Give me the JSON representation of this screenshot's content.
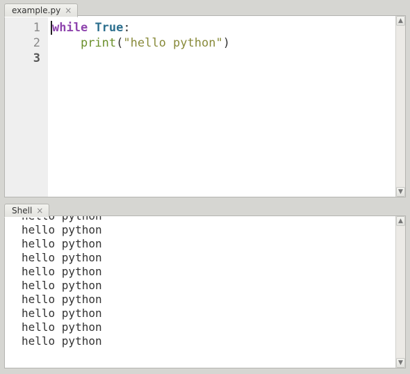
{
  "editor": {
    "tab_label": "example.py",
    "close_glyph": "×",
    "line_numbers": [
      "1",
      "2",
      "3"
    ],
    "current_line_index": 2,
    "code": {
      "kw_while": "while",
      "sp1": " ",
      "bool_true": "True",
      "colon": ":",
      "indent": "    ",
      "fn_print": "print",
      "open_paren": "(",
      "str_hello": "\"hello python\"",
      "close_paren": ")"
    }
  },
  "shell": {
    "tab_label": "Shell",
    "close_glyph": "×",
    "output_line": "hello python",
    "visible_line_count": 10
  },
  "scrollbar": {
    "up_glyph": "▲",
    "down_glyph": "▼"
  }
}
